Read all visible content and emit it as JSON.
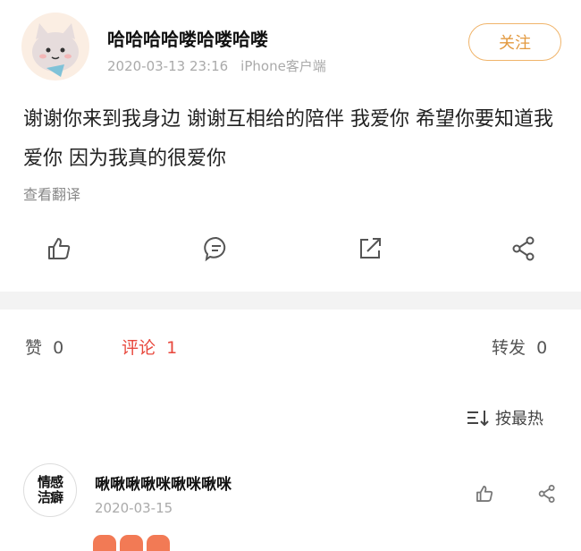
{
  "post": {
    "username": "哈哈哈哈喽哈喽哈喽",
    "timestamp": "2020-03-13 23:16",
    "source": "iPhone客户端",
    "follow_label": "关注",
    "text": "谢谢你来到我身边 谢谢互相给的陪伴 我爱你 希望你要知道我爱你 因为我真的很爱你",
    "translate_label": "查看翻译",
    "actions": [
      "like-icon",
      "comment-icon",
      "repost-icon",
      "share-icon"
    ]
  },
  "stats": {
    "likes_label": "赞",
    "likes_count": "0",
    "comments_label": "评论",
    "comments_count": "1",
    "reposts_label": "转发",
    "reposts_count": "0"
  },
  "sort": {
    "label": "按最热"
  },
  "comment": {
    "avatar_text": "情感\n洁癖",
    "username": "啾啾啾啾咪啾咪啾咪",
    "timestamp": "2020-03-15"
  },
  "colors": {
    "accent": "#e8473c",
    "follow": "#e39a40"
  }
}
